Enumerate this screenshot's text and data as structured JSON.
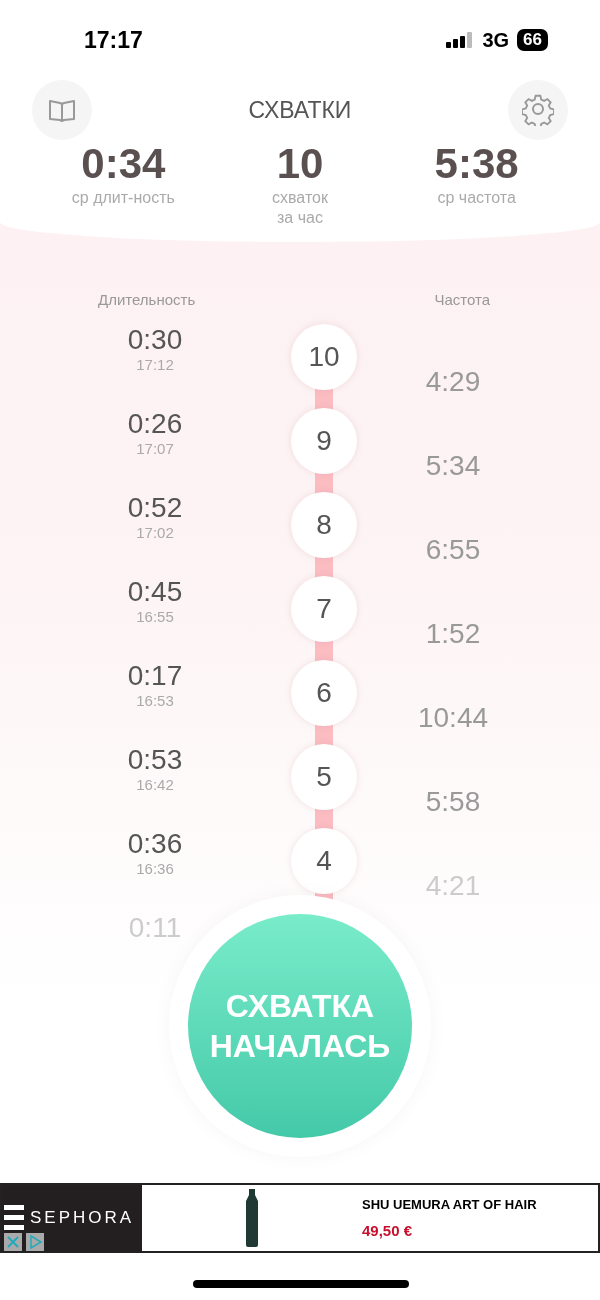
{
  "status_bar": {
    "time": "17:17",
    "network": "3G",
    "battery": "66"
  },
  "header": {
    "title": "СХВАТКИ"
  },
  "stats": [
    {
      "value": "0:34",
      "label": "ср длит-ность"
    },
    {
      "value": "10",
      "label": "схваток за час"
    },
    {
      "value": "5:38",
      "label": "ср частота"
    }
  ],
  "columns": {
    "duration": "Длительность",
    "frequency": "Частота"
  },
  "durations": [
    {
      "duration": "0:30",
      "time": "17:12",
      "faded": false
    },
    {
      "duration": "0:26",
      "time": "17:07",
      "faded": false
    },
    {
      "duration": "0:52",
      "time": "17:02",
      "faded": false
    },
    {
      "duration": "0:45",
      "time": "16:55",
      "faded": false
    },
    {
      "duration": "0:17",
      "time": "16:53",
      "faded": false
    },
    {
      "duration": "0:53",
      "time": "16:42",
      "faded": false
    },
    {
      "duration": "0:36",
      "time": "16:36",
      "faded": false
    },
    {
      "duration": "0:11",
      "faded": true
    }
  ],
  "numbers": [
    "10",
    "9",
    "8",
    "7",
    "6",
    "5",
    "4"
  ],
  "frequencies": [
    {
      "value": "4:29",
      "faded": false
    },
    {
      "value": "5:34",
      "faded": false
    },
    {
      "value": "6:55",
      "faded": false
    },
    {
      "value": "1:52",
      "faded": false
    },
    {
      "value": "10:44",
      "faded": false
    },
    {
      "value": "5:58",
      "faded": false
    },
    {
      "value": "4:21",
      "faded": true
    }
  ],
  "start_button": {
    "label_1": "СХВАТКА",
    "label_2": "НАЧАЛАСЬ"
  },
  "ad": {
    "brand": "SEPHORA",
    "product": "SHU UEMURA ART OF HAIR",
    "price": "49,50 €"
  }
}
